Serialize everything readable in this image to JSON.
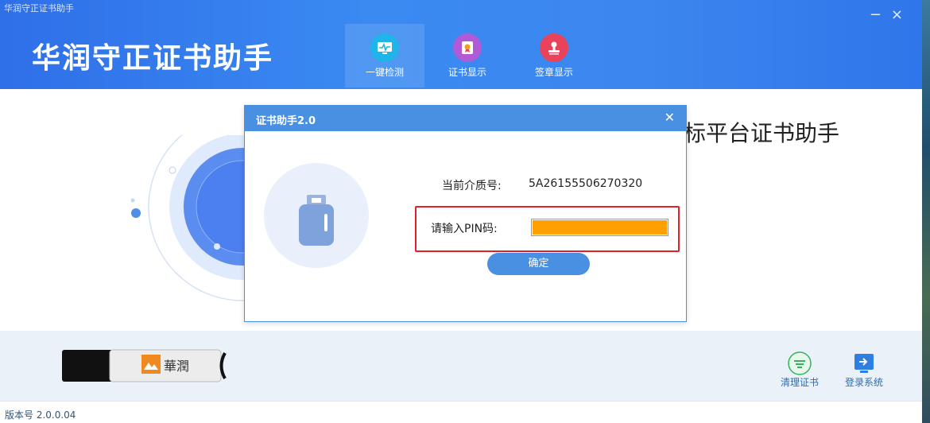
{
  "window": {
    "title": "华润守正证书助手"
  },
  "header": {
    "brand": "华润守正证书助手"
  },
  "nav": [
    {
      "label": "一键检测",
      "icon": "monitor-icon",
      "color": "#1fb5e8"
    },
    {
      "label": "证书显示",
      "icon": "certificate-icon",
      "color": "#b05ad8"
    },
    {
      "label": "签章显示",
      "icon": "seal-icon",
      "color": "#e8435a"
    }
  ],
  "background": {
    "title_fragment": "标平台证书助手"
  },
  "dialog": {
    "title": "证书助手2.0",
    "media_label": "当前介质号:",
    "media_value": "5A26155506270320",
    "pin_label": "请输入PIN码:",
    "pin_value": "",
    "ok_label": "确定"
  },
  "footer": {
    "actions": [
      {
        "label": "清理证书",
        "icon": "clean-certificate-icon"
      },
      {
        "label": "登录系统",
        "icon": "login-icon"
      }
    ]
  },
  "status": {
    "version": "版本号 2.0.0.04"
  },
  "colors": {
    "primary": "#3a86ef",
    "accent": "#4a90e2",
    "highlight": "#e0202a",
    "pin_fill": "#ff9f00"
  }
}
